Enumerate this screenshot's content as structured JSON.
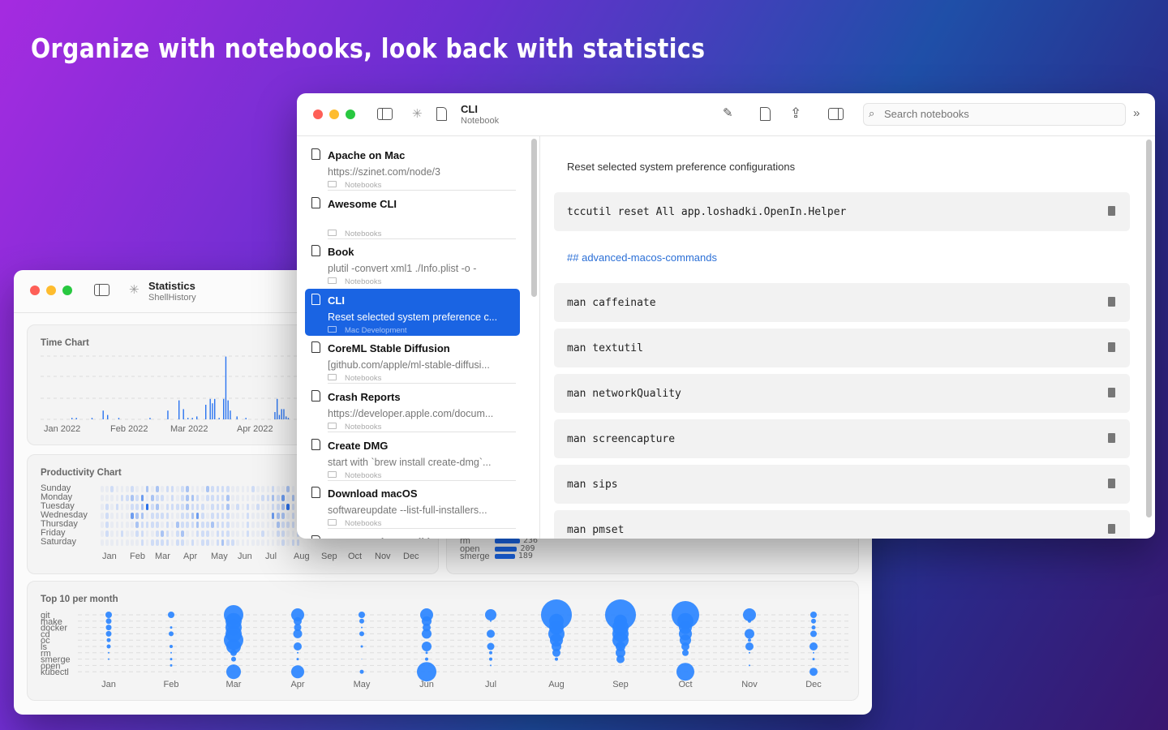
{
  "headline": "Organize with notebooks, look back with statistics",
  "stats_window": {
    "title": "Statistics",
    "subtitle": "ShellHistory",
    "time_chart": {
      "title": "Time Chart",
      "x_labels": [
        "Jan 2022",
        "Feb 2022",
        "Mar 2022",
        "Apr 2022"
      ],
      "bars": [
        [
          "2022-01-05",
          1
        ],
        [
          "2022-01-07",
          1
        ],
        [
          "2022-01-14",
          1
        ],
        [
          "2022-01-19",
          6
        ],
        [
          "2022-01-21",
          3
        ],
        [
          "2022-01-26",
          1
        ],
        [
          "2022-02-09",
          1
        ],
        [
          "2022-02-17",
          6
        ],
        [
          "2022-02-22",
          13
        ],
        [
          "2022-02-24",
          7
        ],
        [
          "2022-02-26",
          1
        ],
        [
          "2022-02-28",
          1
        ],
        [
          "2022-03-02",
          2
        ],
        [
          "2022-03-06",
          10
        ],
        [
          "2022-03-08",
          14
        ],
        [
          "2022-03-09",
          11
        ],
        [
          "2022-03-10",
          14
        ],
        [
          "2022-03-12",
          1
        ],
        [
          "2022-03-14",
          14
        ],
        [
          "2022-03-15",
          43
        ],
        [
          "2022-03-16",
          13
        ],
        [
          "2022-03-17",
          6
        ],
        [
          "2022-03-20",
          2
        ],
        [
          "2022-03-24",
          1
        ],
        [
          "2022-04-06",
          5
        ],
        [
          "2022-04-07",
          14
        ],
        [
          "2022-04-08",
          3
        ],
        [
          "2022-04-09",
          7
        ],
        [
          "2022-04-10",
          7
        ],
        [
          "2022-04-11",
          2
        ],
        [
          "2022-04-12",
          1
        ],
        [
          "2022-04-19",
          4
        ]
      ]
    },
    "productivity": {
      "title": "Productivity Chart",
      "days": [
        "Sunday",
        "Monday",
        "Tuesday",
        "Wednesday",
        "Thursday",
        "Friday",
        "Saturday"
      ],
      "months": [
        "Jan",
        "Feb",
        "Mar",
        "Apr",
        "May",
        "Jun",
        "Jul",
        "Aug",
        "Sep",
        "Oct",
        "Nov",
        "Dec"
      ],
      "grid": [
        "0010001002020110120002111100",
        "0000112130211010122101111200",
        "0101001124120111121110111201",
        "0100003220111100112310111100",
        "0100000211110102111211211100",
        "0100100110012101200111011100",
        "0000000010111101101011012110"
      ]
    },
    "top_commands": [
      {
        "name": "rm",
        "value": 236
      },
      {
        "name": "open",
        "value": 209
      },
      {
        "name": "smerge",
        "value": 189
      }
    ],
    "top10": {
      "title": "Top 10 per month",
      "commands": [
        "git",
        "make",
        "docker",
        "cd",
        "oc",
        "ls",
        "rm",
        "smerge",
        "open",
        "kubectl"
      ],
      "months": [
        "Jan",
        "Feb",
        "Mar",
        "Apr",
        "May",
        "Jun",
        "Jul",
        "Aug",
        "Sep",
        "Oct",
        "Nov",
        "Dec"
      ],
      "sizes": [
        [
          4,
          3.5,
          3.5,
          3.5,
          2.5,
          2.5,
          1,
          1,
          0,
          0
        ],
        [
          4,
          0,
          1.5,
          3,
          0,
          2,
          1,
          1.5,
          1.5,
          0
        ],
        [
          12,
          10,
          10,
          10,
          12,
          9,
          4,
          3,
          1,
          9
        ],
        [
          8,
          5,
          4.5,
          5.5,
          0,
          5,
          1,
          1.5,
          0,
          8
        ],
        [
          4,
          3,
          1,
          3,
          0,
          1.5,
          0,
          0.5,
          0,
          2.5
        ],
        [
          8,
          6,
          5,
          6,
          0,
          6,
          1.5,
          2,
          0,
          12
        ],
        [
          7,
          1,
          0,
          5,
          0,
          4.5,
          2,
          2,
          1,
          0
        ],
        [
          19,
          9,
          9,
          10,
          8,
          6,
          5,
          2,
          0,
          0
        ],
        [
          19,
          8,
          10,
          10,
          10,
          6,
          6,
          5,
          0,
          0
        ],
        [
          17,
          10,
          8,
          8,
          7,
          5,
          4,
          0,
          0,
          11
        ],
        [
          8,
          2,
          0,
          6,
          2,
          5,
          1,
          0,
          1,
          0
        ],
        [
          4,
          3,
          2.5,
          4,
          0,
          5,
          1,
          1.5,
          0,
          5
        ]
      ]
    }
  },
  "main_window": {
    "title": "CLI",
    "subtitle": "Notebook",
    "search_placeholder": "Search notebooks",
    "notes": [
      {
        "title": "Apache on Mac",
        "preview": "https://szinet.com/node/3",
        "folder": "Notebooks"
      },
      {
        "title": "Awesome CLI",
        "preview": "",
        "folder": "Notebooks"
      },
      {
        "title": "Book",
        "preview": "plutil -convert xml1 ./Info.plist -o -",
        "folder": "Notebooks"
      },
      {
        "title": "CLI",
        "preview": "Reset selected system preference c...",
        "folder": "Mac Development",
        "selected": true
      },
      {
        "title": "CoreML Stable Diffusion",
        "preview": "[github.com/apple/ml-stable-diffusi...",
        "folder": "Notebooks"
      },
      {
        "title": "Crash Reports",
        "preview": "https://developer.apple.com/docum...",
        "folder": "Notebooks"
      },
      {
        "title": "Create DMG",
        "preview": "start with `brew install create-dmg`...",
        "folder": "Notebooks"
      },
      {
        "title": "Download macOS",
        "preview": "softwareupdate --list-full-installers...",
        "folder": "Notebooks"
      },
      {
        "title": "Game Porting Toolkit",
        "preview": "",
        "folder": ""
      }
    ],
    "detail": {
      "description": "Reset selected system preference configurations",
      "first_code": "tccutil reset All app.loshadki.OpenIn.Helper",
      "heading_prefix": "##",
      "heading_link": "advanced-macos-commands",
      "codes": [
        "man caffeinate",
        "man textutil",
        "man networkQuality",
        "man screencapture",
        "man sips",
        "man pmset"
      ]
    }
  },
  "colors": {
    "accent": "#1a64e3",
    "bubble": "#2a84ff"
  }
}
